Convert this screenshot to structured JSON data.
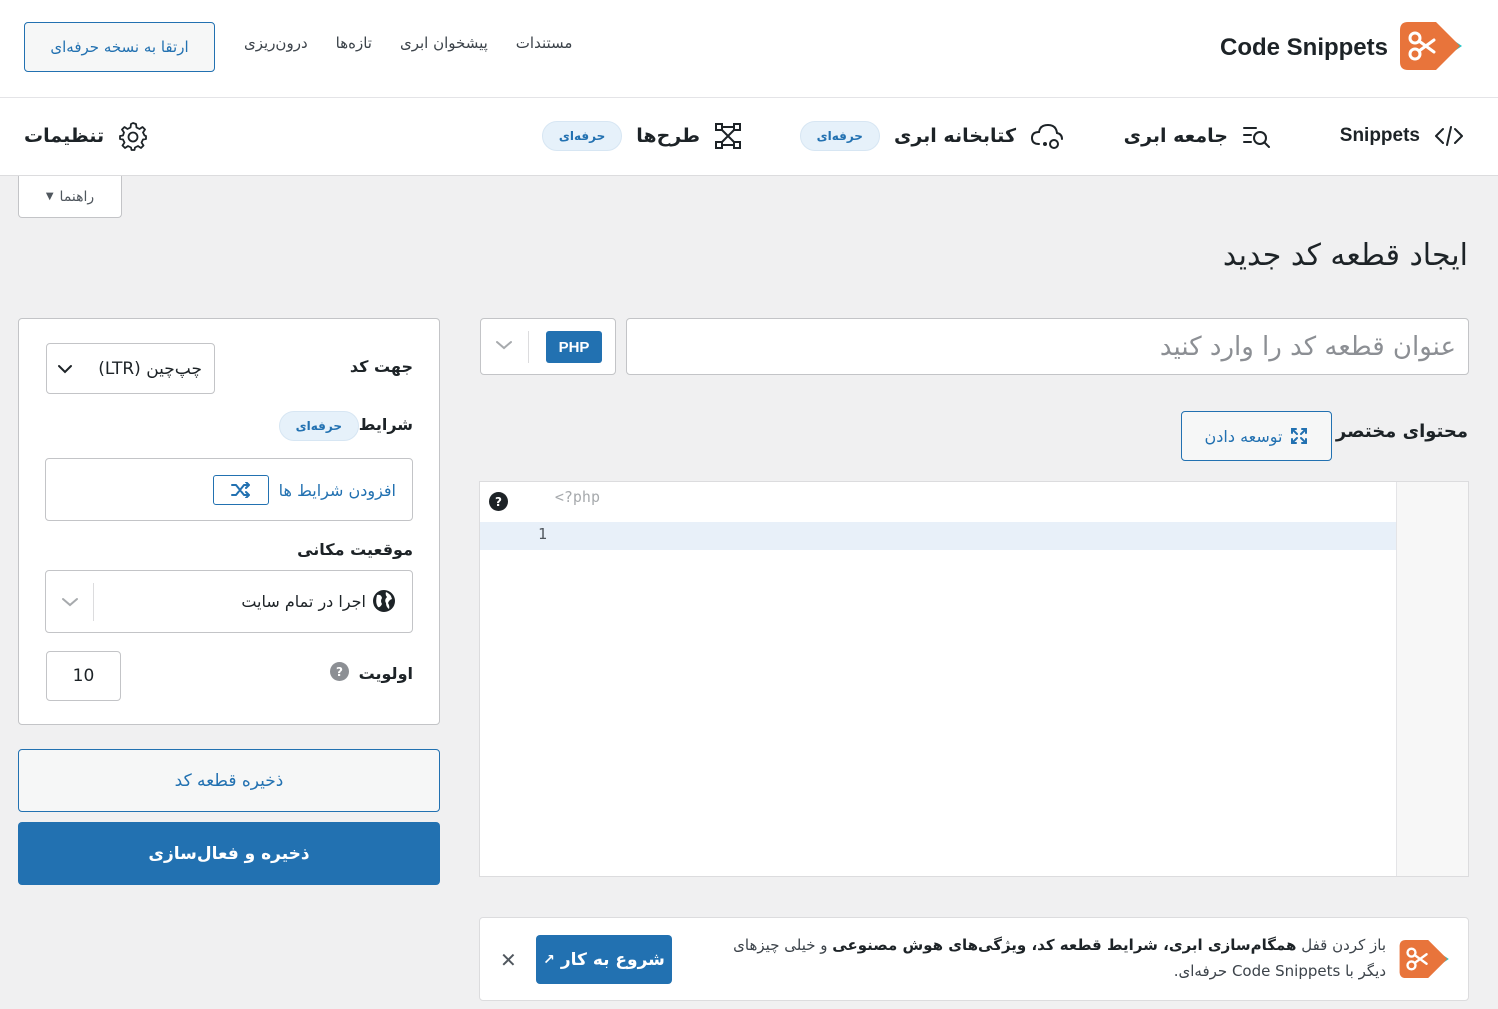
{
  "colors": {
    "accent": "#2271b1",
    "background": "#f0f0f1",
    "logo_orange": "#e8743b",
    "logo_teal": "#20c5c7"
  },
  "header": {
    "brand_name": "Code Snippets",
    "links": [
      "مستندات",
      "پیشخوان ابری",
      "تازه‌ها",
      "درون‌ریزی"
    ],
    "upgrade_label": "ارتقا به نسخه حرفه‌ای"
  },
  "nav": {
    "snippets": "Snippets",
    "community": "جامعه ابری",
    "cloud_library": "کتابخانه ابری",
    "cloud_library_badge": "حرفه‌ای",
    "designs": "طرح‌ها",
    "designs_badge": "حرفه‌ای",
    "settings": "تنظیمات"
  },
  "help_tab": {
    "label": "راهنما"
  },
  "page_title": "ایجاد قطعه کد جدید",
  "form": {
    "title_placeholder": "عنوان قطعه کد را وارد کنید",
    "language": "PHP",
    "description_label": "محتوای مختصر",
    "expand_label": "توسعه دادن"
  },
  "editor": {
    "opening_tag": "<?php",
    "line_numbers": [
      "1"
    ],
    "help_icon_text": "?"
  },
  "notice": {
    "text_prefix": "باز کردن قفل ",
    "bold_1": "همگام‌سازی ابری، شرایط قطعه کد، ویژگی‌های هوش مصنوعی",
    "text_middle": " و خیلی چیزهای دیگر با Code Snippets حرفه‌ای.",
    "button_label": "شروع به کار",
    "close_symbol": "✕"
  },
  "sidebar": {
    "direction_label": "جهت کد",
    "direction_value": "چپ‌چین (LTR)",
    "conditions_label": "شرایط",
    "conditions_badge": "حرفه‌ای",
    "add_conditions": "افزودن شرایط ها",
    "location_label": "موقعیت مکانی",
    "location_value": "اجرا در تمام سایت",
    "priority_label": "اولویت",
    "priority_value": "10",
    "priority_help": "?"
  },
  "actions": {
    "save": "ذخیره قطعه کد",
    "save_activate": "ذخیره و فعال‌سازی"
  }
}
